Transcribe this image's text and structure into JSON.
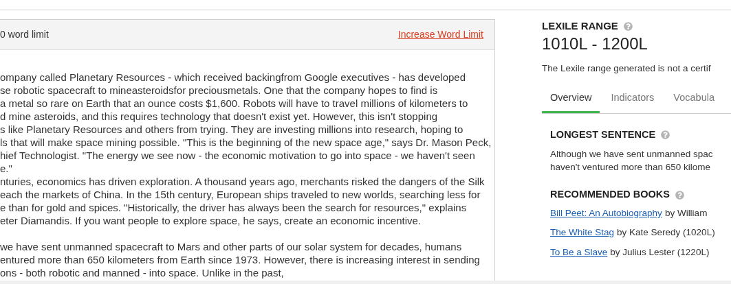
{
  "word_limit": {
    "text": "0 word limit",
    "link": "Increase Word Limit"
  },
  "passage": {
    "paragraphs": [
      [
        "ompany called Planetary Resources - which received backingfrom Google executives - has developed",
        "se robotic spacecraft to mineasteroidsfor preciousmetals. One that the company hopes to find is",
        "a metal so rare on Earth that an ounce costs $1,600. Robots will have to travel millions of kilometers to",
        "d mine asteroids, and this requires technology that doesn't exist yet. However, this isn't stopping",
        "s like Planetary Resources and others from trying. They are investing millions into research, hoping to",
        "ls that will make space mining possible. \"This is the beginning of the new space age,\" says Dr. Mason Peck,",
        "hief Technologist. \"The energy we see now - the economic motivation to go into space - we haven't seen",
        "e.\"",
        "nturies, economics has driven exploration. A thousand years ago, merchants risked the dangers of the Silk",
        "each the markets of China. In the 15th century, European ships traveled to new worlds, searching less for",
        "e than for gold and spices. \"Historically, the driver has always been the search for resources,\" explains",
        "eter Diamandis. If you want people to explore space, he says, create an economic incentive."
      ],
      [
        "we have sent unmanned spacecraft to Mars and other parts of our solar system for decades, humans",
        "entured more than 650 kilometers from Earth since 1973. However, there is increasing interest in sending",
        "ons - both robotic and manned - into space. Unlike in the past,"
      ]
    ]
  },
  "lexile": {
    "heading": "LEXILE RANGE",
    "range": "1010L - 1200L",
    "note": "The Lexile range generated is not a certif"
  },
  "tabs": [
    {
      "label": "Overview",
      "selected": true
    },
    {
      "label": "Indicators",
      "selected": false
    },
    {
      "label": "Vocabula",
      "selected": false
    }
  ],
  "longest_sentence": {
    "heading": "LONGEST SENTENCE",
    "lines": [
      "Although we have sent unmanned spac",
      "haven't ventured more than 650 kilome"
    ]
  },
  "recommended_books": {
    "heading": "RECOMMENDED BOOKS",
    "books": [
      {
        "title": "Bill Peet: An Autobiography",
        "detail": "by William"
      },
      {
        "title": "The White Stag",
        "detail": "by Kate Seredy (1020L)"
      },
      {
        "title": "To Be a Slave",
        "detail": "by Julius Lester (1220L)"
      }
    ]
  }
}
